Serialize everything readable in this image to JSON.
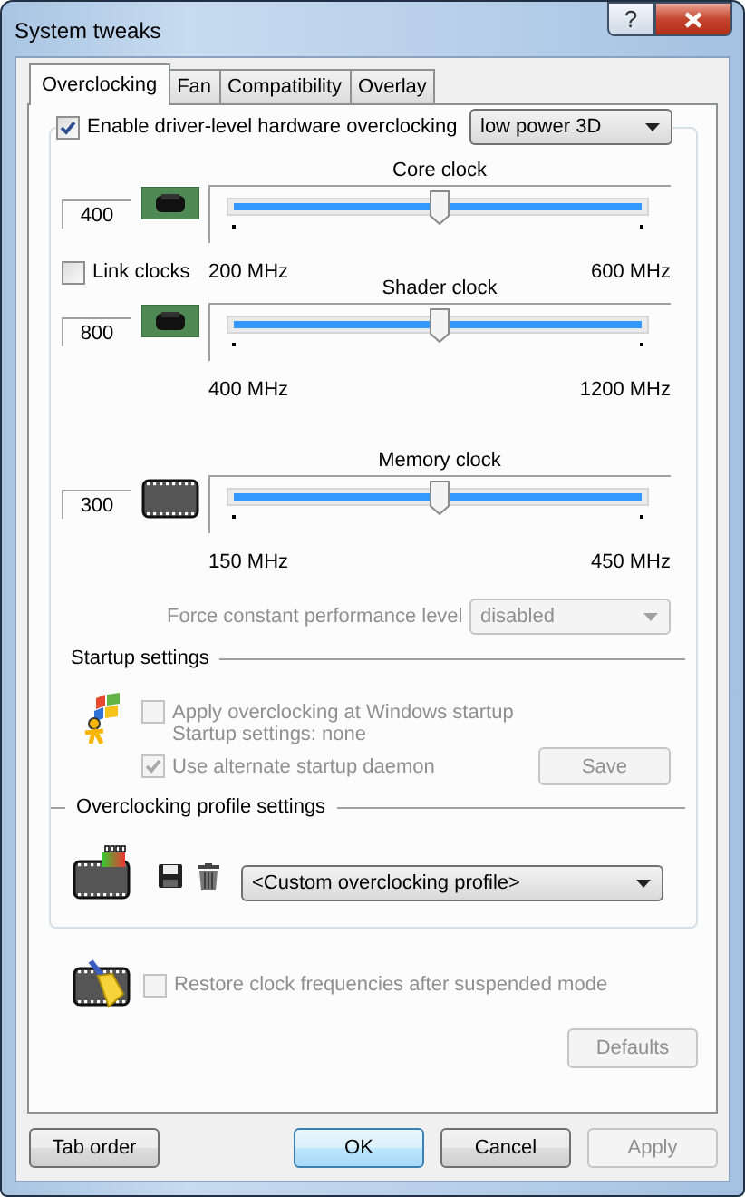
{
  "window": {
    "title": "System tweaks",
    "help_button": "?"
  },
  "tabs": [
    {
      "label": "Overclocking",
      "selected": true
    },
    {
      "label": "Fan",
      "selected": false
    },
    {
      "label": "Compatibility",
      "selected": false
    },
    {
      "label": "Overlay",
      "selected": false
    }
  ],
  "overclocking": {
    "enable": {
      "label": "Enable driver-level hardware overclocking",
      "checked": true
    },
    "preset": {
      "value": "low power 3D"
    }
  },
  "link_clocks": {
    "label": "Link clocks",
    "checked": false
  },
  "clocks": [
    {
      "kind": "core",
      "title": "Core clock",
      "value": "400",
      "min": "200 MHz",
      "max": "600 MHz",
      "level": 0.5
    },
    {
      "kind": "shader",
      "title": "Shader clock",
      "value": "800",
      "min": "400 MHz",
      "max": "1200 MHz",
      "level": 0.5
    },
    {
      "kind": "memory",
      "title": "Memory clock",
      "value": "300",
      "min": "150 MHz",
      "max": "450 MHz",
      "level": 0.5
    }
  ],
  "force_level": {
    "label": "Force constant performance level",
    "value": "disabled",
    "disabled": true
  },
  "startup": {
    "title": "Startup settings",
    "apply": {
      "label": "Apply overclocking at Windows startup",
      "checked": false,
      "disabled": true
    },
    "status": "Startup settings: none",
    "daemon": {
      "label": "Use alternate startup daemon",
      "checked": true,
      "disabled": true
    },
    "save": {
      "label": "Save",
      "disabled": true
    }
  },
  "profile": {
    "title": "Overclocking profile settings",
    "value": "<Custom overclocking profile>"
  },
  "restore": {
    "label": "Restore clock frequencies after suspended mode",
    "checked": false,
    "disabled": true
  },
  "defaults": {
    "label": "Defaults",
    "disabled": true
  },
  "buttons": [
    {
      "label": "Tab order",
      "default": false,
      "disabled": false
    },
    {
      "label": "OK",
      "default": true,
      "disabled": false
    },
    {
      "label": "Cancel",
      "default": false,
      "disabled": false
    },
    {
      "label": "Apply",
      "default": false,
      "disabled": true
    }
  ]
}
